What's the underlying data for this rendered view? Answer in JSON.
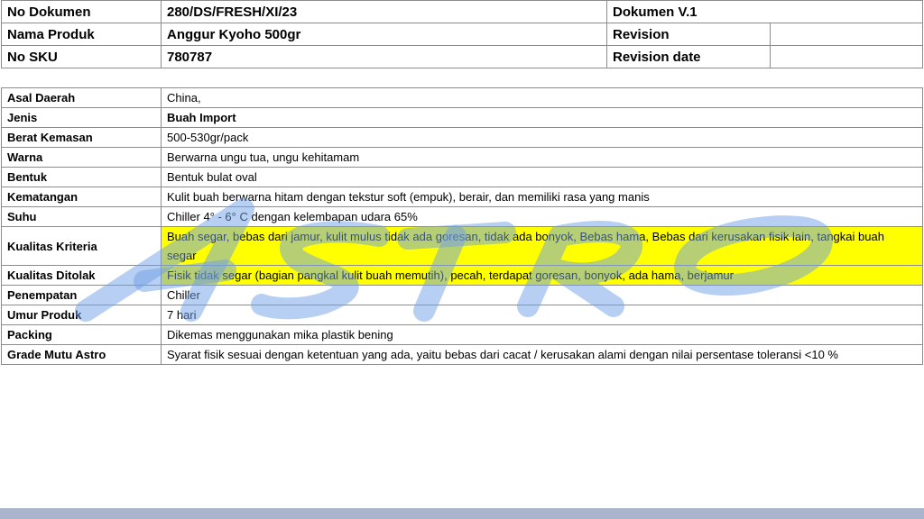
{
  "header": {
    "doc_no_label": "No Dokumen",
    "doc_no_value": "280/DS/FRESH/XI/23",
    "doc_version": "Dokumen V.1",
    "product_label": "Nama Produk",
    "product_value": "Anggur Kyoho 500gr",
    "revision_label": "Revision",
    "revision_value": "",
    "sku_label": "No SKU",
    "sku_value": "780787",
    "revision_date_label": "Revision date",
    "revision_date_value": ""
  },
  "spec": [
    {
      "label": "Asal Daerah",
      "value": "China,"
    },
    {
      "label": "Jenis",
      "value": "Buah Import"
    },
    {
      "label": "Berat Kemasan",
      "value": "500-530gr/pack"
    },
    {
      "label": "Warna",
      "value": "Berwarna ungu tua, ungu kehitamam"
    },
    {
      "label": "Bentuk",
      "value": "Bentuk bulat oval"
    },
    {
      "label": "Kematangan",
      "value": "Kulit buah berwarna hitam dengan tekstur soft (empuk), berair, dan memiliki rasa yang manis"
    },
    {
      "label": "Suhu",
      "value": "Chiller 4° - 6° C dengan kelembapan udara 65%"
    },
    {
      "label": "Kualitas Kriteria",
      "value": "Buah segar, bebas dari jamur, kulit mulus tidak ada goresan, tidak ada bonyok, Bebas hama, Bebas dari kerusakan fisik lain, tangkai buah segar"
    },
    {
      "label": "Kualitas Ditolak",
      "value": "Fisik tidak segar (bagian pangkal kulit buah memutih), pecah, terdapat goresan, bonyok, ada hama, berjamur"
    },
    {
      "label": "Penempatan",
      "value": "Chiller"
    },
    {
      "label": "Umur Produk",
      "value": "7 hari"
    },
    {
      "label": "Packing",
      "value": "Dikemas menggunakan mika plastik bening"
    },
    {
      "label": "Grade Mutu Astro",
      "value": "Syarat fisik sesuai dengan ketentuan yang ada, yaitu bebas dari cacat / kerusakan alami dengan  nilai persentase toleransi <10 %"
    }
  ],
  "watermark": {
    "color": "#6f9fe8",
    "logo": "astro-logo-watermark"
  },
  "colors": {
    "highlight": "#ffff00",
    "footer_band": "#aab4cc"
  }
}
